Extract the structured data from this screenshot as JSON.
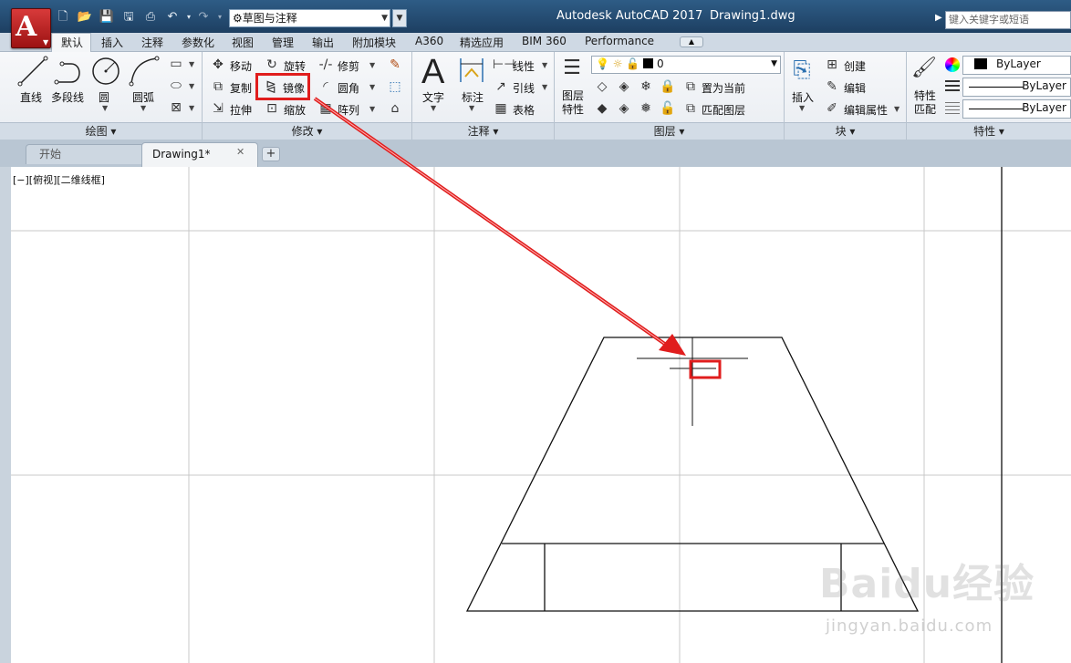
{
  "title_bar": {
    "logo_letter": "A",
    "workspace": "草图与注释",
    "app_title": "Autodesk AutoCAD 2017",
    "doc_title": "Drawing1.dwg",
    "search_placeholder": "键入关键字或短语"
  },
  "ribbon_tabs": [
    "默认",
    "插入",
    "注释",
    "参数化",
    "视图",
    "管理",
    "输出",
    "附加模块",
    "A360",
    "精选应用",
    "BIM 360",
    "Performance"
  ],
  "panels": {
    "draw": {
      "title": "绘图",
      "tools": [
        "直线",
        "多段线",
        "圆",
        "圆弧"
      ]
    },
    "modify": {
      "title": "修改",
      "tools": [
        "移动",
        "旋转",
        "修剪",
        "复制",
        "镜像",
        "圆角",
        "拉伸",
        "缩放",
        "阵列"
      ]
    },
    "annotation": {
      "title": "注释",
      "tools": [
        "文字",
        "标注",
        "线性",
        "引线",
        "表格"
      ]
    },
    "layers": {
      "title": "图层",
      "layer_props": "图层\n特性",
      "current_layer": "0",
      "set_current": "置为当前",
      "match_layer": "匹配图层"
    },
    "block": {
      "title": "块",
      "insert": "插入",
      "create": "创建",
      "edit": "编辑",
      "edit_attr": "编辑属性"
    },
    "properties": {
      "title": "特性",
      "match": "特性\n匹配",
      "color": "ByLayer",
      "linetype": "ByLayer",
      "lineweight": "ByLayer"
    }
  },
  "file_tabs": [
    "开始",
    "Drawing1*"
  ],
  "viewport_label": "[−][俯视][二维线框]",
  "watermark": {
    "text": "Baidu经验",
    "sub": "jingyan.baidu.com"
  },
  "colors": {
    "highlight": "#e01d1d",
    "titlebar": "#1d3f61",
    "logo": "#c62828"
  }
}
